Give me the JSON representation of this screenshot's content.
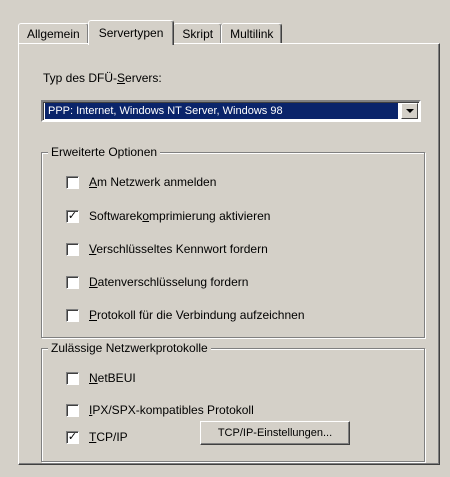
{
  "tabs": [
    {
      "label": "Allgemein",
      "active": false
    },
    {
      "label": "Servertypen",
      "active": true
    },
    {
      "label": "Skript",
      "active": false
    },
    {
      "label": "Multilink",
      "active": false
    }
  ],
  "server_type": {
    "label_pre": "Typ des DFÜ-",
    "label_u": "S",
    "label_post": "ervers:",
    "selected": "PPP: Internet, Windows NT Server, Windows 98"
  },
  "advanced": {
    "title": "Erweiterte Optionen",
    "options": [
      {
        "u": "A",
        "rest": "m Netzwerk anmelden",
        "pre": "",
        "checked": false
      },
      {
        "pre": "Softwarek",
        "u": "o",
        "rest": "mprimierung aktivieren",
        "checked": true
      },
      {
        "pre": "",
        "u": "V",
        "rest": "erschlüsseltes Kennwort fordern",
        "checked": false
      },
      {
        "pre": "",
        "u": "D",
        "rest": "atenverschlüsselung fordern",
        "checked": false
      },
      {
        "pre": "",
        "u": "P",
        "rest": "rotokoll für die Verbindung aufzeichnen",
        "checked": false
      }
    ]
  },
  "protocols": {
    "title": "Zulässige Netzwerkprotokolle",
    "items": [
      {
        "pre": "",
        "u": "N",
        "rest": "etBEUI",
        "checked": false
      },
      {
        "pre": "",
        "u": "I",
        "rest": "PX/SPX-kompatibles Protokoll",
        "checked": false
      },
      {
        "pre": "",
        "u": "T",
        "rest": "CP/IP",
        "checked": true
      }
    ],
    "tcp_button": "TCP/IP-Einstellungen..."
  },
  "check_mark": "✓"
}
